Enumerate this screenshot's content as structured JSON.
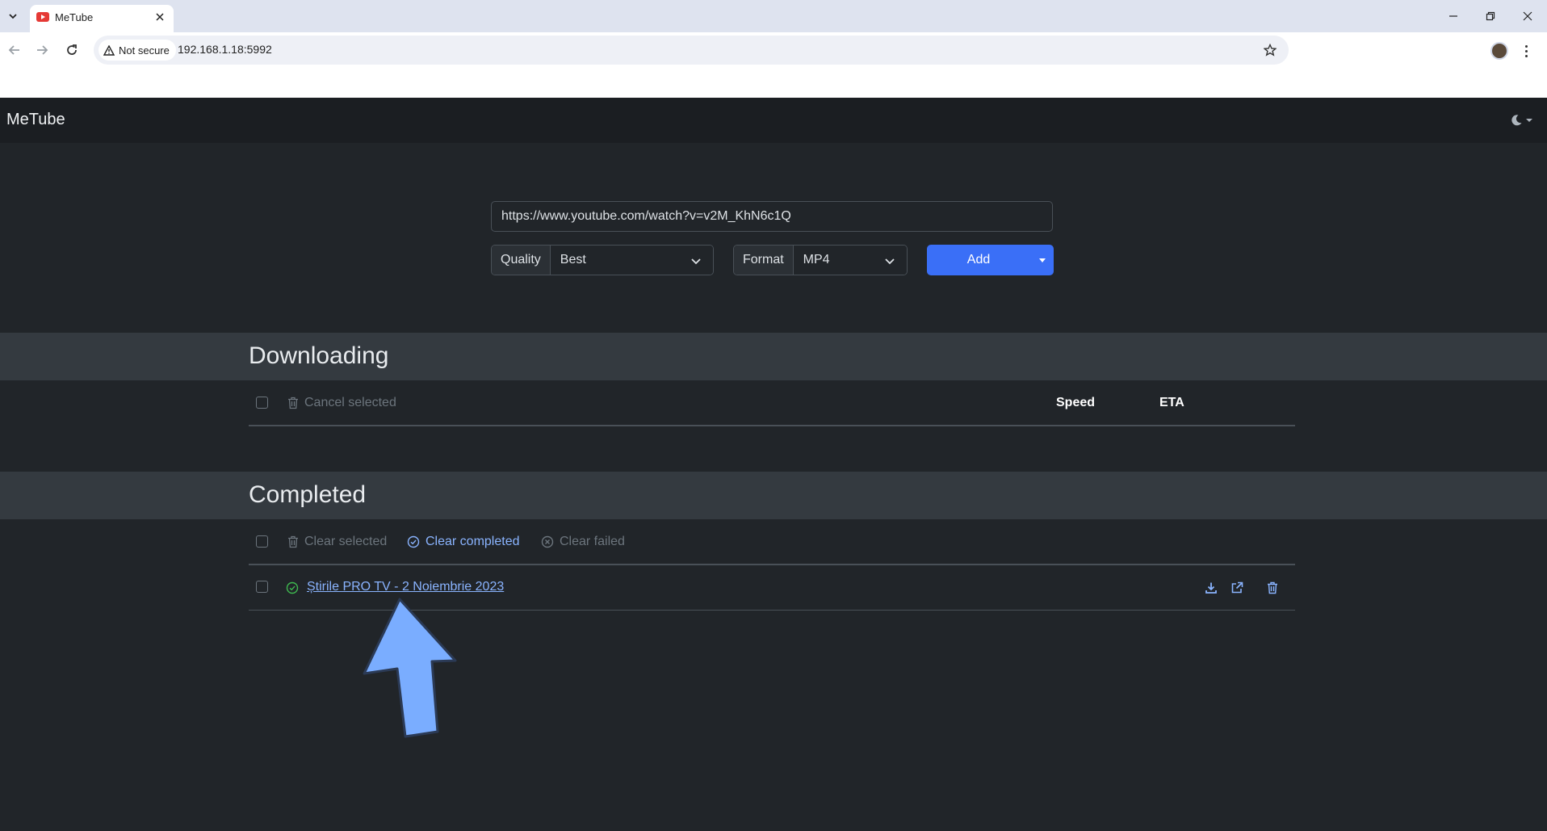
{
  "browser": {
    "tab_title": "MeTube",
    "security_label": "Not secure",
    "url": "192.168.1.18:5992"
  },
  "app": {
    "brand": "MeTube",
    "url_input_value": "https://www.youtube.com/watch?v=v2M_KhN6c1Q",
    "quality_label": "Quality",
    "quality_value": "Best",
    "format_label": "Format",
    "format_value": "MP4",
    "add_label": "Add"
  },
  "downloading": {
    "title": "Downloading",
    "cancel_selected": "Cancel selected",
    "col_speed": "Speed",
    "col_eta": "ETA"
  },
  "completed": {
    "title": "Completed",
    "clear_selected": "Clear selected",
    "clear_completed": "Clear completed",
    "clear_failed": "Clear failed",
    "items": [
      {
        "title": "Știrile PRO TV - 2 Noiembrie 2023",
        "status": "success"
      }
    ]
  },
  "colors": {
    "accent": "#3a6ff7",
    "link": "#8ab4ff",
    "success": "#3fb950",
    "annotation_arrow": "#7aadff"
  },
  "icons": [
    "chevron-down-icon",
    "close-icon",
    "minimize-icon",
    "restore-icon",
    "back-icon",
    "forward-icon",
    "reload-icon",
    "warning-icon",
    "star-icon",
    "moon-icon",
    "trash-icon",
    "check-circle-icon",
    "x-circle-icon",
    "download-icon",
    "external-link-icon"
  ]
}
